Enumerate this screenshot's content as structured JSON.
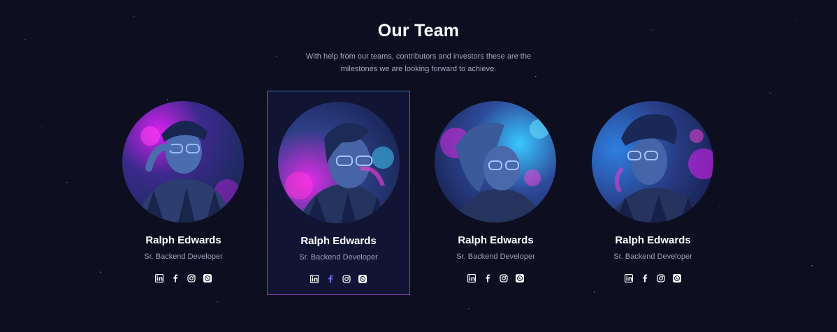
{
  "section": {
    "title": "Our Team",
    "subtitle": "With help from our teams, contributors and investors these are the milestones we are looking forward to achieve."
  },
  "team": [
    {
      "name": "Ralph Edwards",
      "role": "Sr. Backend Developer",
      "active": false
    },
    {
      "name": "Ralph Edwards",
      "role": "Sr. Backend Developer",
      "active": true
    },
    {
      "name": "Ralph Edwards",
      "role": "Sr. Backend Developer",
      "active": false
    },
    {
      "name": "Ralph Edwards",
      "role": "Sr. Backend Developer",
      "active": false
    }
  ],
  "social_icons": [
    "linkedin-icon",
    "facebook-icon",
    "instagram-icon",
    "whatsapp-icon"
  ],
  "colors": {
    "background": "#0d0e20",
    "card_active_bg": "#121433",
    "accent_pink": "#d21ff0",
    "accent_blue": "#2f6fd6",
    "facebook_active": "#6b73e0"
  }
}
